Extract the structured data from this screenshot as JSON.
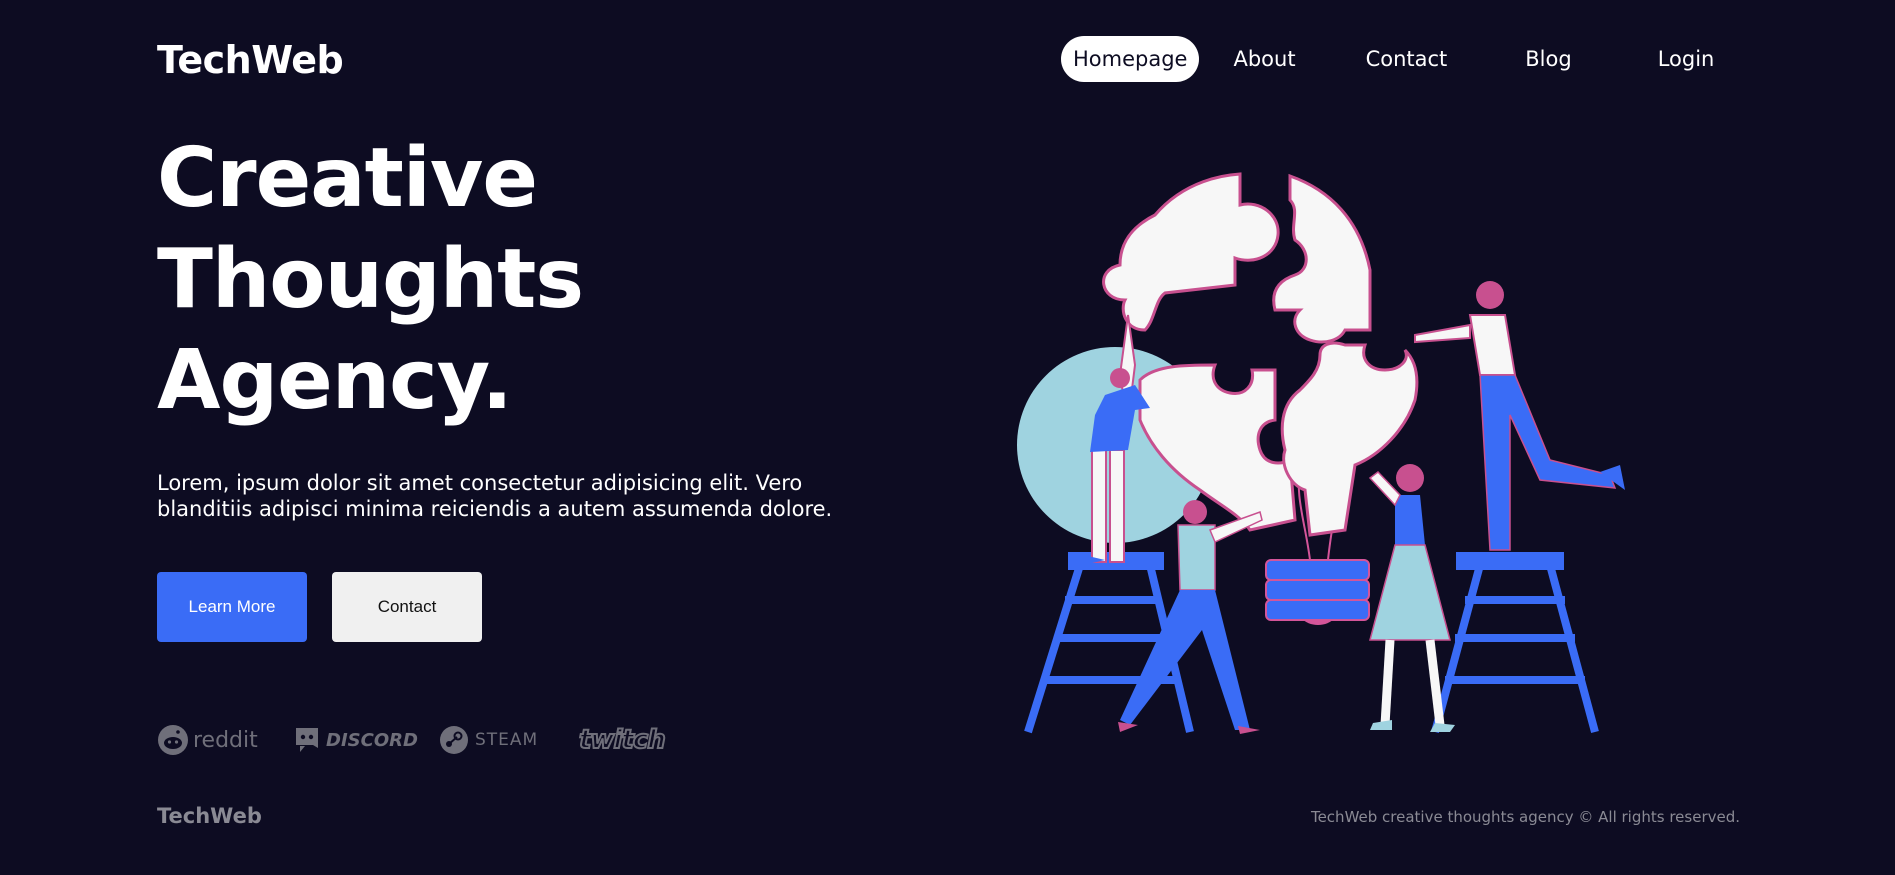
{
  "header": {
    "logo": "TechWeb",
    "nav": [
      {
        "label": "Homepage",
        "active": true
      },
      {
        "label": "About",
        "active": false
      },
      {
        "label": "Contact",
        "active": false
      },
      {
        "label": "Blog",
        "active": false
      },
      {
        "label": "Login",
        "active": false
      }
    ]
  },
  "hero": {
    "title_lines": [
      "Creative",
      "Thoughts",
      "Agency."
    ],
    "description": "Lorem, ipsum dolor sit amet consectetur adipisicing elit. Vero blanditiis adipisci minima reiciendis a autem assumenda dolore.",
    "primary_button": "Learn More",
    "secondary_button": "Contact"
  },
  "brands": [
    {
      "name": "reddit",
      "icon": "reddit-icon"
    },
    {
      "name": "DISCORD",
      "icon": "discord-icon"
    },
    {
      "name": "STEAM",
      "icon": "steam-icon"
    },
    {
      "name": "twitch",
      "icon": "twitch-icon"
    }
  ],
  "footer": {
    "logo": "TechWeb",
    "copyright": "TechWeb creative thoughts agency © All rights reserved."
  },
  "colors": {
    "background": "#0d0c22",
    "accent": "#3a6cf6",
    "illustration_pink": "#d4559a",
    "illustration_blue": "#3a6cf6",
    "illustration_lightblue": "#9fd3e0"
  }
}
